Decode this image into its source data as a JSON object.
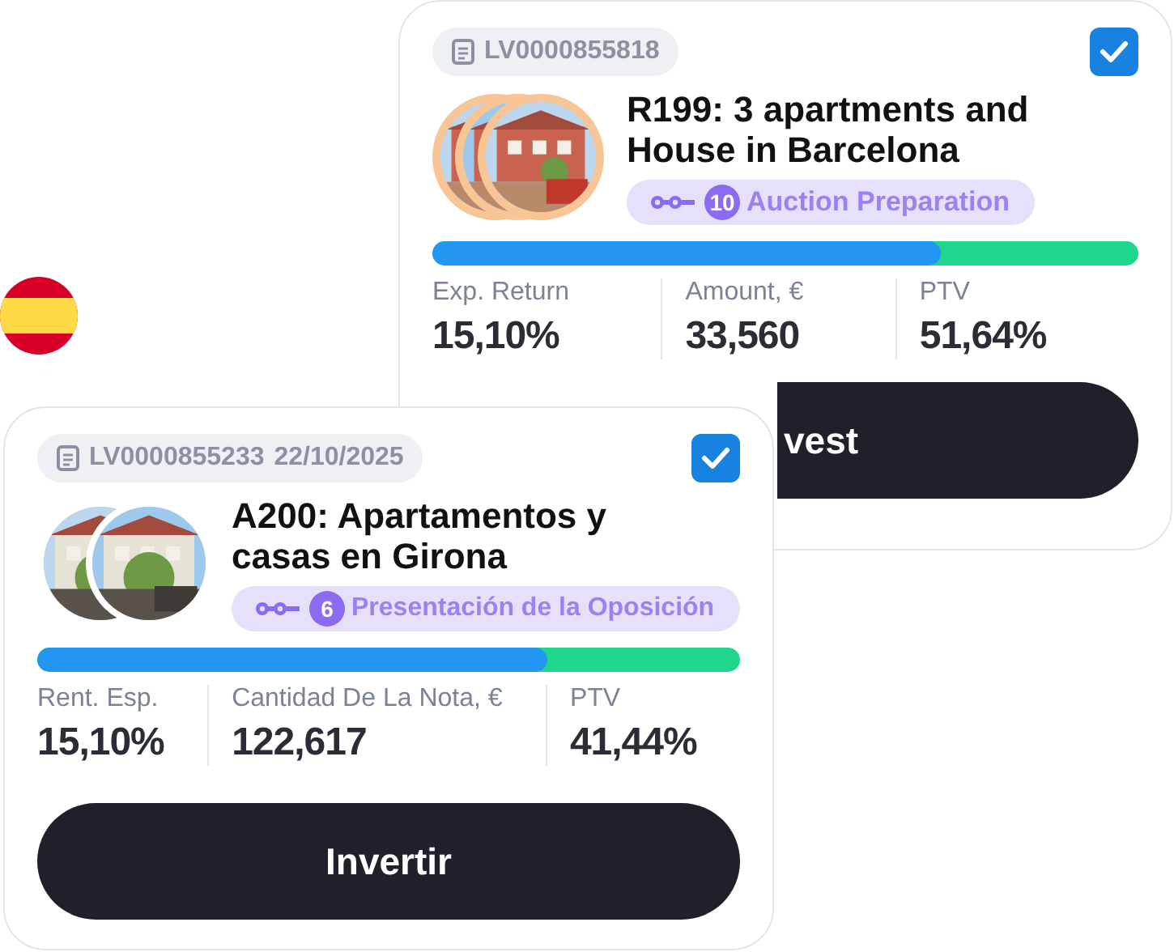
{
  "cards": [
    {
      "id": "LV0000855818",
      "checked": true,
      "ringed_photos": true,
      "photos": [
        {
          "kind": "picture"
        },
        {
          "kind": "picture"
        },
        {
          "kind": "picture"
        }
      ],
      "title": "R199: 3 apartments and House in Barcelona",
      "stage": {
        "number": "10",
        "label": "Auction Preparation"
      },
      "level": 0.72,
      "stats": [
        {
          "label": "Exp. Return",
          "value": "15,10%"
        },
        {
          "label": "Amount, €",
          "value": "33,560"
        },
        {
          "label": "PTV",
          "value": "51,64%"
        }
      ],
      "button": "vest",
      "partly_covered": true
    },
    {
      "id": "LV0000855233",
      "date": "22/10/2025",
      "checked": true,
      "ringed_photos": false,
      "photos": [
        {
          "kind": "picture"
        },
        {
          "kind": "picture"
        }
      ],
      "title": "A200: Apartamentos y casas en Girona",
      "stage": {
        "number": "6",
        "label": "Presentación de la Oposición"
      },
      "level": 0.725,
      "stats": [
        {
          "label": "Rent. Esp.",
          "value": "15,10%"
        },
        {
          "label": "Cantidad De La Nota, €",
          "value": "122,617"
        },
        {
          "label": "PTV",
          "value": "41,44%"
        }
      ],
      "button": "Invertir",
      "partly_covered": false
    }
  ]
}
